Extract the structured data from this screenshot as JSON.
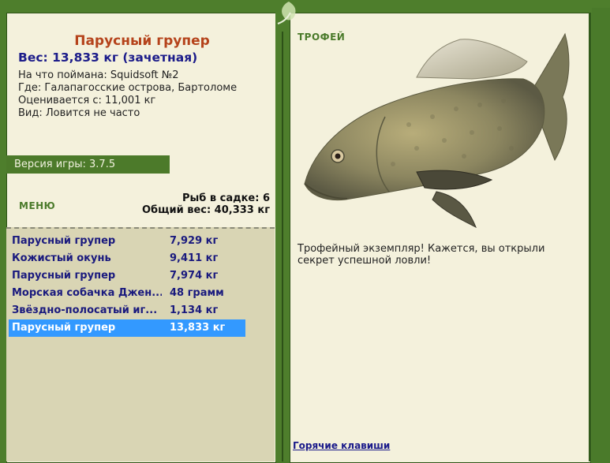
{
  "fish_card": {
    "title": "Парусный групер",
    "weight": "Вес: 13,833 кг (зачетная)",
    "caught_with": "На что поймана: Squidsoft №2",
    "location": "Где: Галапагосские острова, Бартоломе",
    "valued_from": "Оценивается с: 11,001 кг",
    "kind": "Вид: Ловится не часто"
  },
  "version": "Версия игры: 3.7.5",
  "menu_label": "МЕНЮ",
  "stats": {
    "fish_in_keepnet": "Рыб в садке: 6",
    "total_weight": "Общий вес: 40,333 кг"
  },
  "catch_list": [
    {
      "name": "Парусный групер",
      "weight": "7,929 кг"
    },
    {
      "name": "Кожистый окунь",
      "weight": "9,411 кг"
    },
    {
      "name": "Парусный групер",
      "weight": "7,974 кг"
    },
    {
      "name": "Морская собачка Джен...",
      "weight": "48 грамм"
    },
    {
      "name": "Звёздно-полосатый иг...",
      "weight": "1,134 кг"
    },
    {
      "name": "Парусный групер",
      "weight": "13,833 кг",
      "selected": true
    }
  ],
  "trophy": {
    "label": "ТРОФЕЙ",
    "text": "Трофейный экземпляр! Кажется, вы открыли секрет успешной ловли!"
  },
  "hotkeys_link": "Горячие клавиши",
  "colors": {
    "frame_green": "#4e7e2c",
    "panel_bg": "#f4f1dc",
    "selection": "#3399ff",
    "title_color": "#b5431b",
    "link_color": "#1a1a7e"
  }
}
